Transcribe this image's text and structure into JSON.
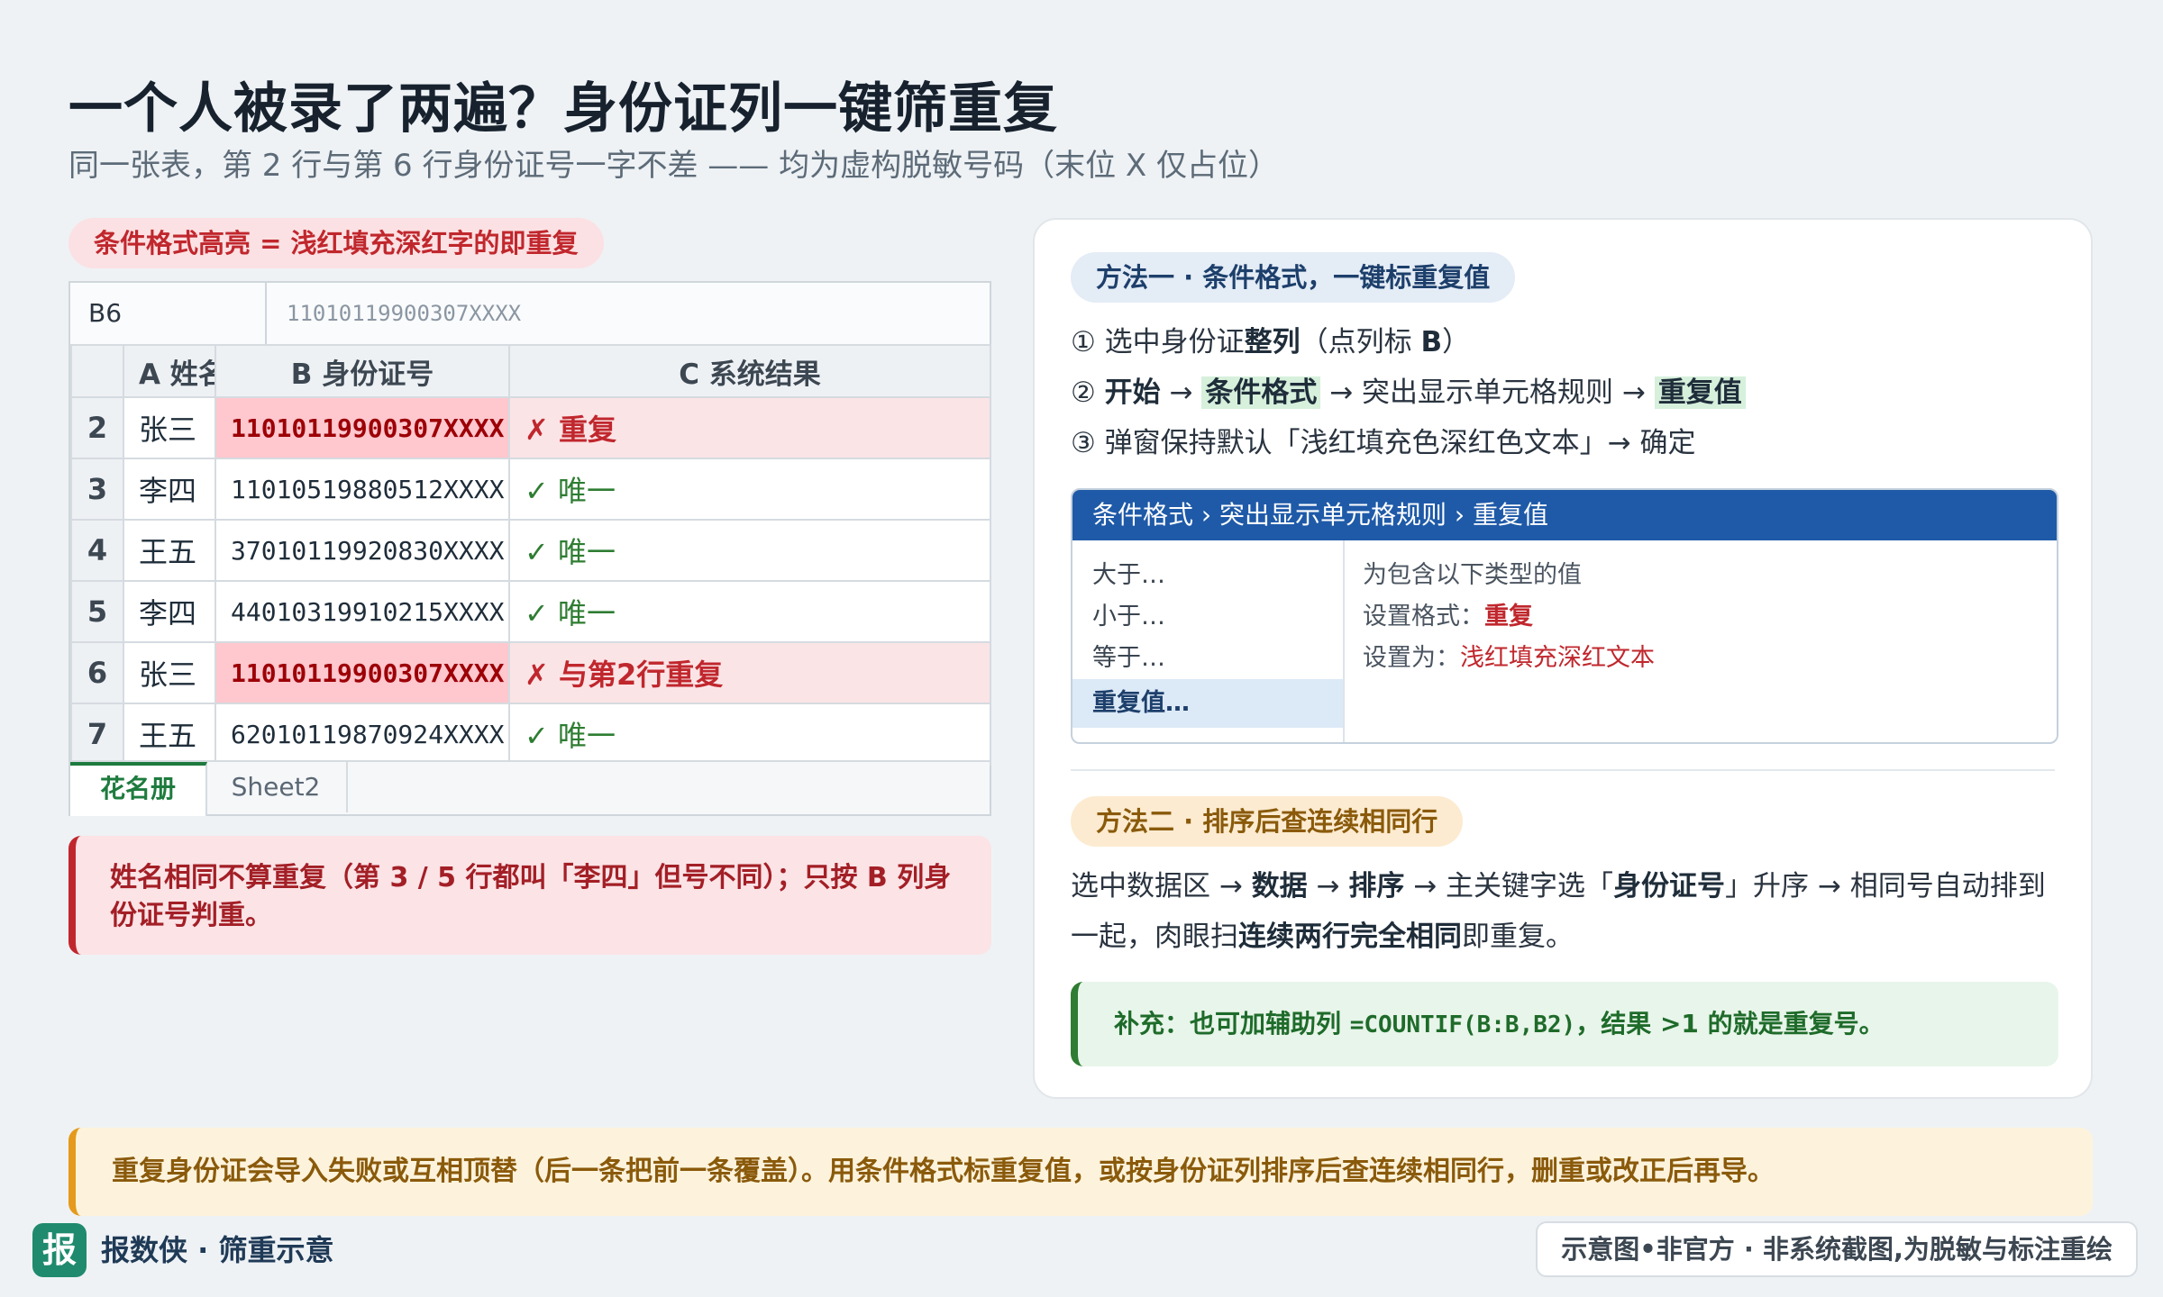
{
  "page": {
    "title": "一个人被录了两遍？身份证列一键筛重复",
    "subtitle": "同一张表，第 2 行与第 6 行身份证号一字不差 —— 均为虚构脱敏号码（末位 X 仅占位）"
  },
  "legend_pill": "条件格式高亮 = 浅红填充深红字的即重复",
  "sheet": {
    "cell_ref": "B6",
    "formula_value": "11010119900307XXXX",
    "headers": [
      "",
      "A 姓名",
      "B 身份证号",
      "C 系统结果"
    ],
    "rows": [
      {
        "row": "2",
        "name": "张三",
        "id": "11010119900307XXXX",
        "result": "✗ 重复",
        "duplicate": true
      },
      {
        "row": "3",
        "name": "李四",
        "id": "11010519880512XXXX",
        "result": "✓ 唯一",
        "duplicate": false
      },
      {
        "row": "4",
        "name": "王五",
        "id": "37010119920830XXXX",
        "result": "✓ 唯一",
        "duplicate": false
      },
      {
        "row": "5",
        "name": "李四",
        "id": "44010319910215XXXX",
        "result": "✓ 唯一",
        "duplicate": false
      },
      {
        "row": "6",
        "name": "张三",
        "id": "11010119900307XXXX",
        "result": "✗ 与第2行重复",
        "duplicate": true
      },
      {
        "row": "7",
        "name": "王五",
        "id": "62010119870924XXXX",
        "result": "✓ 唯一",
        "duplicate": false
      }
    ],
    "tabs": [
      "花名册",
      "Sheet2"
    ],
    "active_tab": "花名册"
  },
  "left_note": "姓名相同不算重复（第 3 / 5 行都叫「李四」但号不同）；只按 B 列身份证号判重。",
  "method1": {
    "title": "方法一 · 条件格式，一键标重复值",
    "step1": {
      "num": "①",
      "a": "选中身份证",
      "b": "整列",
      "c": "（点列标 ",
      "d": "B",
      "e": "）"
    },
    "step2": {
      "num": "②",
      "a": "开始",
      "b": " → ",
      "c": "条件格式",
      "d": " → 突出显示单元格规则 → ",
      "e": "重复值"
    },
    "step3": {
      "num": "③",
      "a": "弹窗保持默认「浅红填充色深红色文本」→ 确定"
    },
    "dialog": {
      "header": "条件格式 › 突出显示单元格规则 › 重复值",
      "menu": [
        "大于…",
        "小于…",
        "等于…"
      ],
      "selected": "重复值…",
      "line1": "为包含以下类型的值",
      "line2_label": "设置格式：",
      "line2_value": "重复",
      "line3_label": "设置为：",
      "line3_value": "浅红填充深红文本"
    }
  },
  "method2": {
    "title": "方法二 · 排序后查连续相同行",
    "p1": "选中数据区 → ",
    "b1": "数据",
    "p2": " → ",
    "b2": "排序",
    "p3": " → 主关键字选「",
    "b3": "身份证号",
    "p4": "」升序 → 相同号自动排到一起，肉眼扫",
    "b4": "连续两行完全相同",
    "p5": "即重复。"
  },
  "tip": {
    "prefix": "补充：也可加辅助列 ",
    "formula": "=COUNTIF(B:B,B2)",
    "suffix": "，结果 >1 的就是重复号。"
  },
  "bottom_note": "重复身份证会导入失败或互相顶替（后一条把前一条覆盖）。用条件格式标重复值，或按身份证列排序后查连续相同行，删重或改正后再导。",
  "footer": {
    "logo": "报",
    "brand": "报数侠 · 筛重示意",
    "disclaimer": "示意图•非官方 · 非系统截图,为脱敏与标注重绘"
  },
  "colors": {
    "duplicate_fill": "#ffc7ce",
    "duplicate_text": "#9c0006",
    "unique_text": "#2e7d32",
    "dialog_header": "#1f5aa8",
    "accent_amber": "#e59a1c"
  }
}
